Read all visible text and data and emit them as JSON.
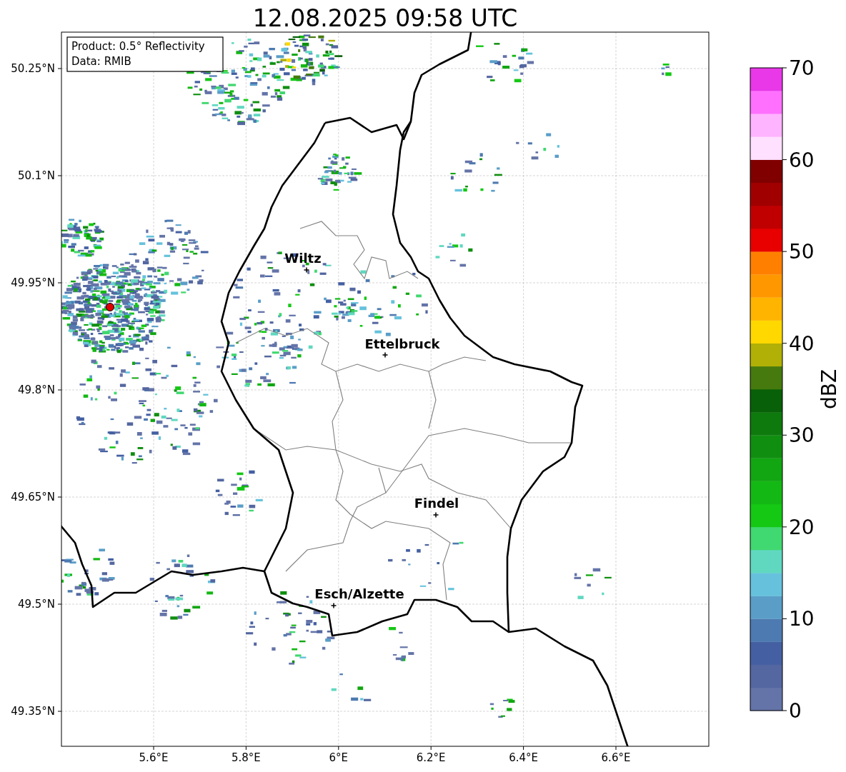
{
  "title": "12.08.2025 09:58 UTC",
  "info_box": [
    "Product: 0.5° Reflectivity",
    "Data: RMIB"
  ],
  "y_ticks": [
    "50.25°N",
    "50.1°N",
    "49.95°N",
    "49.8°N",
    "49.65°N",
    "49.5°N",
    "49.35°N"
  ],
  "x_ticks": [
    "5.6°E",
    "5.8°E",
    "6°E",
    "6.2°E",
    "6.4°E",
    "6.6°E"
  ],
  "cities": [
    {
      "name": "Wiltz"
    },
    {
      "name": "Ettelbruck"
    },
    {
      "name": "Findel"
    },
    {
      "name": "Esch/Alzette"
    }
  ],
  "colorbar": {
    "label": "dBZ",
    "ticks": [
      "70",
      "60",
      "50",
      "40",
      "30",
      "20",
      "10",
      "0"
    ],
    "segments": [
      {
        "color": "#6474a8"
      },
      {
        "color": "#5467a0"
      },
      {
        "color": "#4560a2"
      },
      {
        "color": "#4d7ab0"
      },
      {
        "color": "#5a9ec8"
      },
      {
        "color": "#66c2dc"
      },
      {
        "color": "#60d8c0"
      },
      {
        "color": "#40d870"
      },
      {
        "color": "#14c814"
      },
      {
        "color": "#14b814"
      },
      {
        "color": "#12a612"
      },
      {
        "color": "#108e10"
      },
      {
        "color": "#0e7a0e"
      },
      {
        "color": "#086008"
      },
      {
        "color": "#467a0e"
      },
      {
        "color": "#b0b006"
      },
      {
        "color": "#ffd800"
      },
      {
        "color": "#ffb400"
      },
      {
        "color": "#ff9800"
      },
      {
        "color": "#ff8000"
      },
      {
        "color": "#e80000"
      },
      {
        "color": "#c00000"
      },
      {
        "color": "#a00000"
      },
      {
        "color": "#800000"
      },
      {
        "color": "#ffe0ff"
      },
      {
        "color": "#ffb4ff"
      },
      {
        "color": "#ff70ff"
      },
      {
        "color": "#e838e8"
      }
    ]
  }
}
